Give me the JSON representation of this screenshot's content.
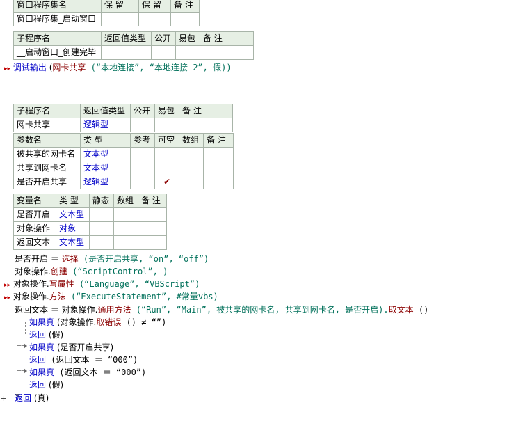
{
  "assembly_table": {
    "headers": [
      "窗口程序集名",
      "保 留",
      "保 留",
      "备 注"
    ],
    "row": [
      "窗口程序集_启动窗口",
      "",
      "",
      ""
    ]
  },
  "sub1_table": {
    "headers": [
      "子程序名",
      "返回值类型",
      "公开",
      "易包",
      "备 注"
    ],
    "row": [
      "__启动窗口_创建完毕",
      "",
      "",
      "",
      ""
    ]
  },
  "line_debug": {
    "cmd": "调试输出",
    "open": " (",
    "fn": "网卡共享",
    "args": " (“本地连接”, “本地连接 2”, 假))"
  },
  "sub2_table": {
    "headers": [
      "子程序名",
      "返回值类型",
      "公开",
      "易包",
      "备 注"
    ],
    "row": [
      "网卡共享",
      "逻辑型",
      "",
      "",
      ""
    ]
  },
  "params_table": {
    "headers": [
      "参数名",
      "类 型",
      "参考",
      "可空",
      "数组",
      "备 注"
    ],
    "rows": [
      [
        "被共享的网卡名",
        "文本型",
        "",
        "",
        "",
        ""
      ],
      [
        "共享到网卡名",
        "文本型",
        "",
        "",
        "",
        ""
      ],
      [
        "是否开启共享",
        "逻辑型",
        "",
        "✔",
        "",
        ""
      ]
    ]
  },
  "vars_table": {
    "headers": [
      "变量名",
      "类 型",
      "静态",
      "数组",
      "备 注"
    ],
    "rows": [
      [
        "是否开启",
        "文本型",
        "",
        "",
        ""
      ],
      [
        "对象操作",
        "对象",
        "",
        "",
        ""
      ],
      [
        "返回文本",
        "文本型",
        "",
        "",
        ""
      ]
    ]
  },
  "code": {
    "l1a": "是否开启 ＝ ",
    "l1fn": "选择",
    "l1b": " (是否开启共享, “on”, “off”)",
    "l2a": "对象操作.",
    "l2fn": "创建",
    "l2b": " (“ScriptControl”, )",
    "l3a": "对象操作.",
    "l3fn": "写属性",
    "l3b": " (“Language”, “VBScript”)",
    "l4a": "对象操作.",
    "l4fn": "方法",
    "l4b": " (“ExecuteStatement”, #常量vbs)",
    "l5a": "返回文本 ＝ 对象操作.",
    "l5fn": "通用方法",
    "l5b": " (“Run”, “Main”, 被共享的网卡名, 共享到网卡名, 是否开启).",
    "l5fn2": "取文本",
    "l5c": " ()",
    "if1kw": "如果真",
    "if1a": " (对象操作.",
    "if1fn": "取错误",
    "if1b": " () ≠ “”)",
    "ret1": "返回",
    "ret1b": " (假)",
    "if2kw": "如果真",
    "if2b": " (是否开启共享)",
    "ret2": "返回",
    "ret2b": " (返回文本 ＝ “000”)",
    "if3kw": "如果真",
    "if3b": " (返回文本 ＝ “000”)",
    "ret3": "返回",
    "ret3b": " (假)",
    "ret4": "返回",
    "ret4b": " (真)"
  },
  "colors": {
    "header_bg": "#e6efe4",
    "border": "#a8b4a8",
    "keyword": "#0000c8",
    "function": "#8b0000",
    "string": "#00705a"
  }
}
